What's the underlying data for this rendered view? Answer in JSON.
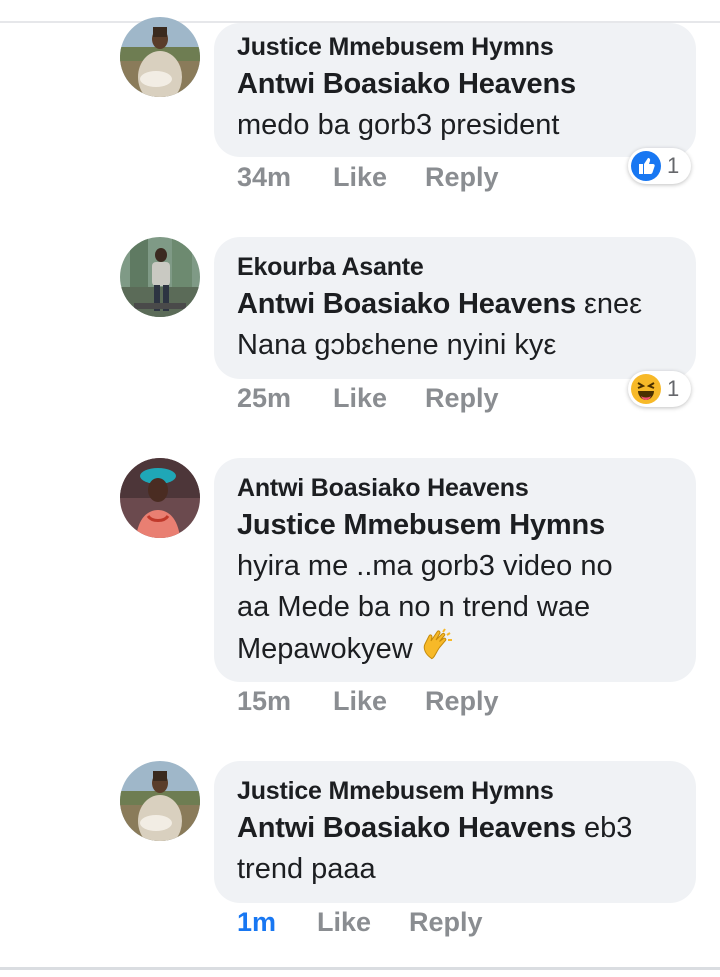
{
  "comments": [
    {
      "author": "Justice Mmebusem Hymns",
      "mention": "Antwi Boasiako Heavens",
      "text": "medo ba gorb3 president",
      "time": "34m",
      "like_label": "Like",
      "reply_label": "Reply",
      "reaction": {
        "icon": "like-icon",
        "count": "1"
      },
      "avatar": "avatar-man-with-goat"
    },
    {
      "author": "Ekourba Asante",
      "mention": "Antwi Boasiako Heavens",
      "text_inline": "εneε",
      "text": "Nana gɔbεhene nyini kyε",
      "time": "25m",
      "like_label": "Like",
      "reply_label": "Reply",
      "reaction": {
        "icon": "haha-icon",
        "count": "1"
      },
      "avatar": "avatar-man-standing"
    },
    {
      "author": "Antwi Boasiako Heavens",
      "mention": "Justice Mmebusem Hymns",
      "text_line1": "hyira me ..ma gorb3 video  no",
      "text_line2": "aa  Mede ba no n trend wae",
      "text_line3": "Mepawokyew",
      "emoji": "clapping-hands-icon",
      "time": "15m",
      "like_label": "Like",
      "reply_label": "Reply",
      "avatar": "avatar-woman-with-hat"
    },
    {
      "author": "Justice Mmebusem Hymns",
      "mention": "Antwi Boasiako Heavens",
      "text_inline": "eb3",
      "text": "trend paaa",
      "time": "1m",
      "like_label": "Like",
      "reply_label": "Reply",
      "avatar": "avatar-man-with-goat"
    }
  ],
  "colors": {
    "bubble": "#f0f2f5",
    "text": "#1c1e21",
    "meta": "#8a8d91",
    "recent_time": "#1877f2",
    "like_blue": "#1877f2",
    "haha_yellow": "#f7b928"
  }
}
